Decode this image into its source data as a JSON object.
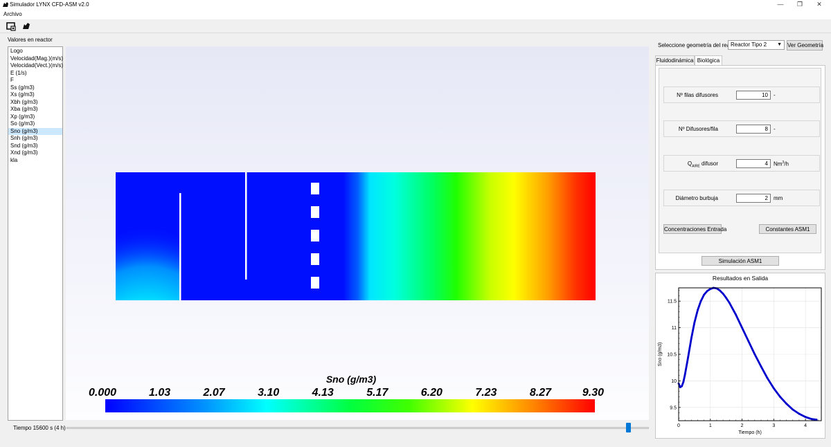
{
  "window": {
    "title": "Simulador LYNX CFD-ASM v2.0",
    "minimize_glyph": "—",
    "maximize_glyph": "❐",
    "close_glyph": "✕"
  },
  "menu": {
    "archivo": "Archivo"
  },
  "toolbar": {
    "icons": [
      "screenshot-icon",
      "lynx-logo-icon"
    ]
  },
  "left": {
    "label": "Valores en reactor",
    "items": [
      "Logo",
      "Velocidad(Mag.)(m/s)",
      "Velocidad(Vect.)(m/s)",
      "E (1/s)",
      "F",
      "Ss (g/m3)",
      "Xs (g/m3)",
      "Xbh (g/m3)",
      "Xba (g/m3)",
      "Xp (g/m3)",
      "So (g/m3)",
      "Sno (g/m3)",
      "Snh (g/m3)",
      "Snd (g/m3)",
      "Xnd (g/m3)",
      "kla"
    ],
    "selected_index": 11
  },
  "viewport": {
    "colorbar_title": "Sno (g/m3)",
    "colorbar_ticks": [
      "0.000",
      "1.03",
      "2.07",
      "3.10",
      "4.13",
      "5.17",
      "6.20",
      "7.23",
      "8.27",
      "9.30"
    ]
  },
  "timeline": {
    "label": "Tiempo 15600 s (4 h)",
    "position": 0.97
  },
  "right": {
    "geometry_label": "Seleccione geometría del reactor",
    "geometry_value": "Reactor Tipo 2",
    "ver_geometria": "Ver Geometría",
    "tabs": [
      "Fluidodinámica",
      "Biológica"
    ],
    "active_tab": 1,
    "params": {
      "filas": {
        "label": "Nº filas difusores",
        "value": "10",
        "unit": "-"
      },
      "difusores": {
        "label": "Nº Difusores/fila",
        "value": "8",
        "unit": "-"
      },
      "qaire": {
        "label_q": "Q",
        "label_sub": "AIRE",
        "label_rest": " difusor",
        "value": "4",
        "unit": "Nm",
        "unit_sup": "3",
        "unit_rest": "/h"
      },
      "diametro": {
        "label": "Diámetro burbuja",
        "value": "2",
        "unit": "mm"
      }
    },
    "btn_concentraciones": "Concentraciones Entrada",
    "btn_constantes": "Constantes ASM1",
    "btn_simulacion": "Simulación ASM1"
  },
  "chart_data": {
    "type": "line",
    "title": "Resultados en Salida",
    "xlabel": "Tiempo (h)",
    "ylabel": "Sno (g/m3)",
    "xlim": [
      0,
      4.5
    ],
    "ylim": [
      9.25,
      11.75
    ],
    "xticks": [
      "0",
      "1",
      "2",
      "3",
      "4"
    ],
    "yticks": [
      "9.5",
      "10",
      "10.5",
      "11",
      "11.5"
    ],
    "grid": true,
    "color": "#0000cc",
    "x": [
      0,
      0.05,
      0.1,
      0.15,
      0.2,
      0.3,
      0.4,
      0.5,
      0.6,
      0.7,
      0.8,
      0.9,
      1.0,
      1.1,
      1.2,
      1.3,
      1.4,
      1.5,
      1.6,
      1.8,
      2.0,
      2.2,
      2.4,
      2.6,
      2.8,
      3.0,
      3.2,
      3.4,
      3.6,
      3.8,
      4.0,
      4.2,
      4.35
    ],
    "y": [
      9.95,
      9.88,
      9.9,
      9.98,
      10.12,
      10.45,
      10.8,
      11.1,
      11.33,
      11.5,
      11.62,
      11.69,
      11.73,
      11.75,
      11.74,
      11.7,
      11.64,
      11.56,
      11.47,
      11.25,
      11.0,
      10.75,
      10.5,
      10.27,
      10.05,
      9.86,
      9.7,
      9.57,
      9.46,
      9.38,
      9.32,
      9.28,
      9.27
    ]
  }
}
